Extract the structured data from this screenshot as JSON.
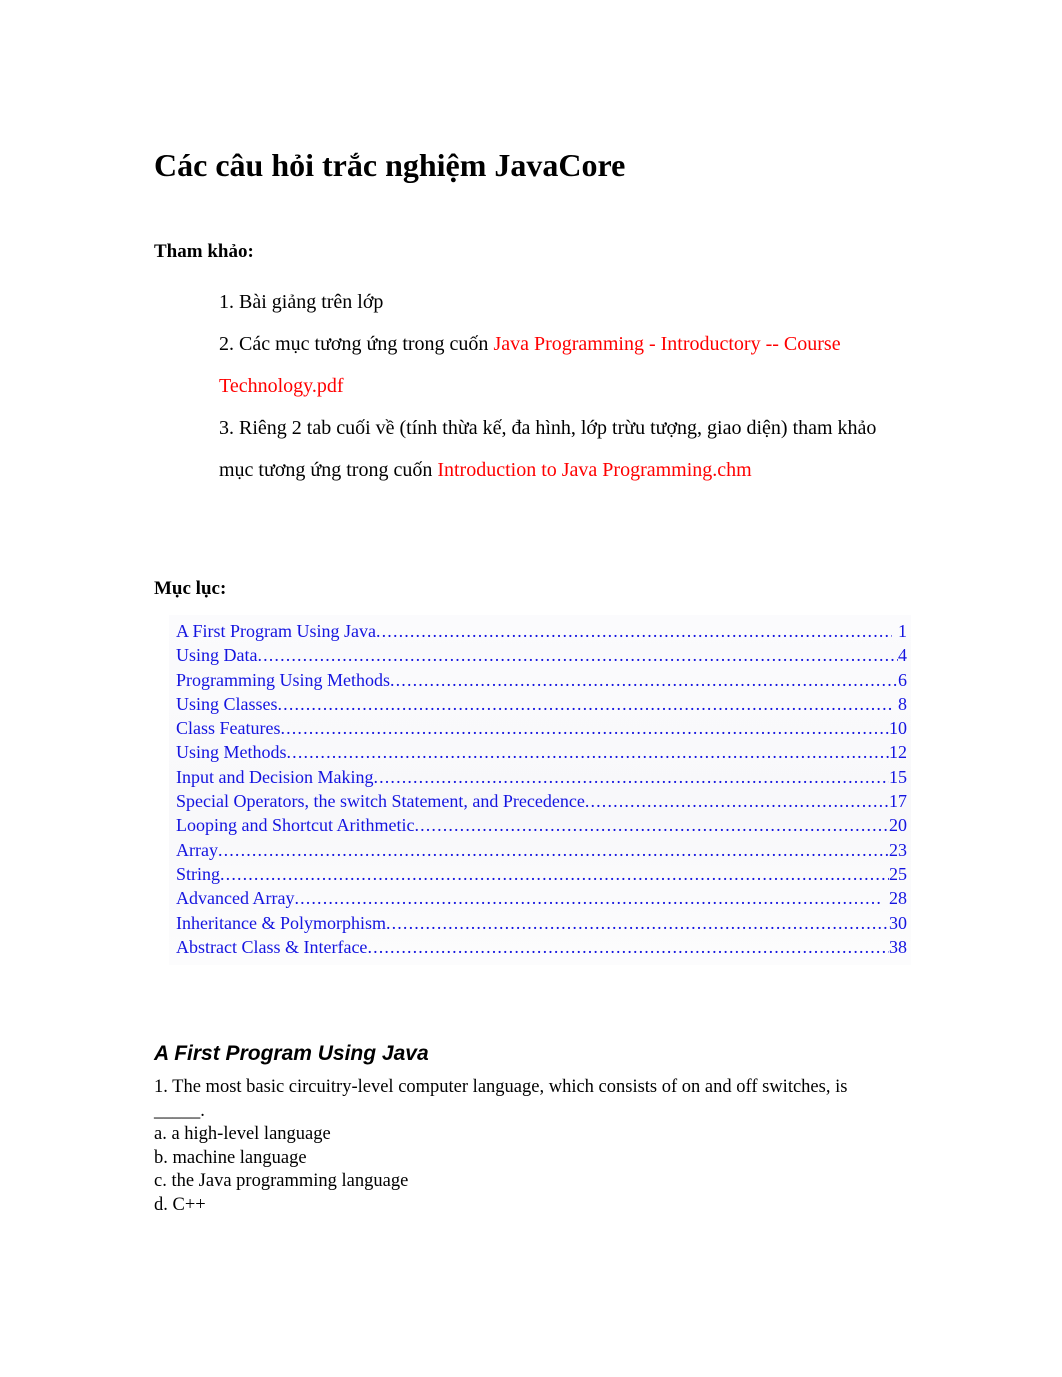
{
  "document": {
    "title": "Các câu hỏi trắc nghiệm JavaCore"
  },
  "references": {
    "heading": "Tham khảo:",
    "items": [
      {
        "black_prefix": "1. Bài giảng trên lớp",
        "red_suffix": ""
      },
      {
        "black_prefix": "2. Các mục tương ứng  trong  cuốn ",
        "red_suffix": "Java Programming - Introductory -- Course Technology.pdf"
      },
      {
        "black_prefix": "3. Riêng 2 tab cuối về (tính thừa kế, đa hình, lớp trừu tượng, giao diện) tham khảo mục tương ứng  trong  cuốn ",
        "red_suffix": "Introduction to Java Programming.chm"
      }
    ]
  },
  "toc": {
    "heading": "Mục lục:",
    "link_color": "#1414e0",
    "leader": "................................................................................................................................",
    "entries": [
      {
        "title": "A First Program Using Java",
        "page": "1",
        "space_before_page": true
      },
      {
        "title": "Using Data",
        "page": "4",
        "space_before_page": false
      },
      {
        "title": "Programming Using Methods",
        "page": "6",
        "space_before_page": false
      },
      {
        "title": "Using Classes",
        "page": "8",
        "space_before_page": true
      },
      {
        "title": "Class Features",
        "page": "10",
        "space_before_page": false
      },
      {
        "title": "Using Methods",
        "page": "12",
        "space_before_page": false
      },
      {
        "title": "Input and Decision Making",
        "page": "15",
        "space_before_page": false
      },
      {
        "title": "Special Operators, the switch Statement, and Precedence",
        "page": "17",
        "space_before_page": false
      },
      {
        "title": "Looping and Shortcut Arithmetic",
        "page": "20",
        "space_before_page": false
      },
      {
        "title": "Array",
        "page": "23",
        "space_before_page": false
      },
      {
        "title": "String",
        "page": "25",
        "space_before_page": false
      },
      {
        "title": "Advanced Array",
        "page": "28",
        "space_before_page": true
      },
      {
        "title": "Inheritance & Polymorphism",
        "page": "30",
        "space_before_page": false
      },
      {
        "title": "Abstract Class & Interface",
        "page": "38",
        "space_before_page": false
      }
    ]
  },
  "section": {
    "heading": "A First Program Using Java",
    "question": {
      "text": "1. The most basic circuitry-level computer language, which consists of on and off switches, is _____.",
      "options": [
        "a. a high-level language",
        "b. machine language",
        "c. the Java programming language",
        "d. C++"
      ]
    }
  },
  "colors": {
    "text": "#000000",
    "accent_red": "#ff0000",
    "accent_blue": "#1414e0",
    "page_background": "#ffffff"
  }
}
